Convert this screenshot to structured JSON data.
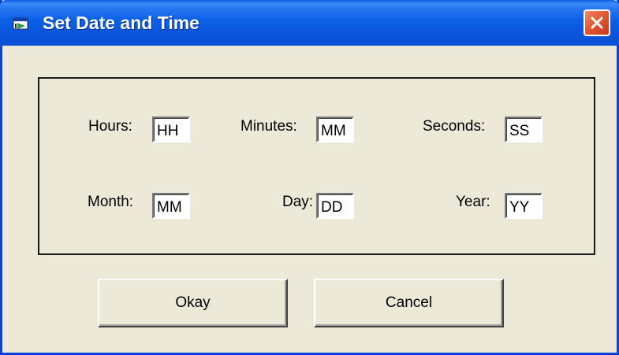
{
  "window": {
    "title": "Set Date and Time",
    "title_icon": "app-window-icon",
    "close_icon": "close-icon",
    "accent_color": "#0a5ce8",
    "close_color": "#e15a32"
  },
  "time_fields": {
    "hours": {
      "label": "Hours:",
      "value": "HH"
    },
    "minutes": {
      "label": "Minutes:",
      "value": "MM"
    },
    "seconds": {
      "label": "Seconds:",
      "value": "SS"
    }
  },
  "date_fields": {
    "month": {
      "label": "Month:",
      "value": "MM"
    },
    "day": {
      "label": "Day:",
      "value": "DD"
    },
    "year": {
      "label": "Year:",
      "value": "YY"
    }
  },
  "buttons": {
    "okay": "Okay",
    "cancel": "Cancel"
  }
}
